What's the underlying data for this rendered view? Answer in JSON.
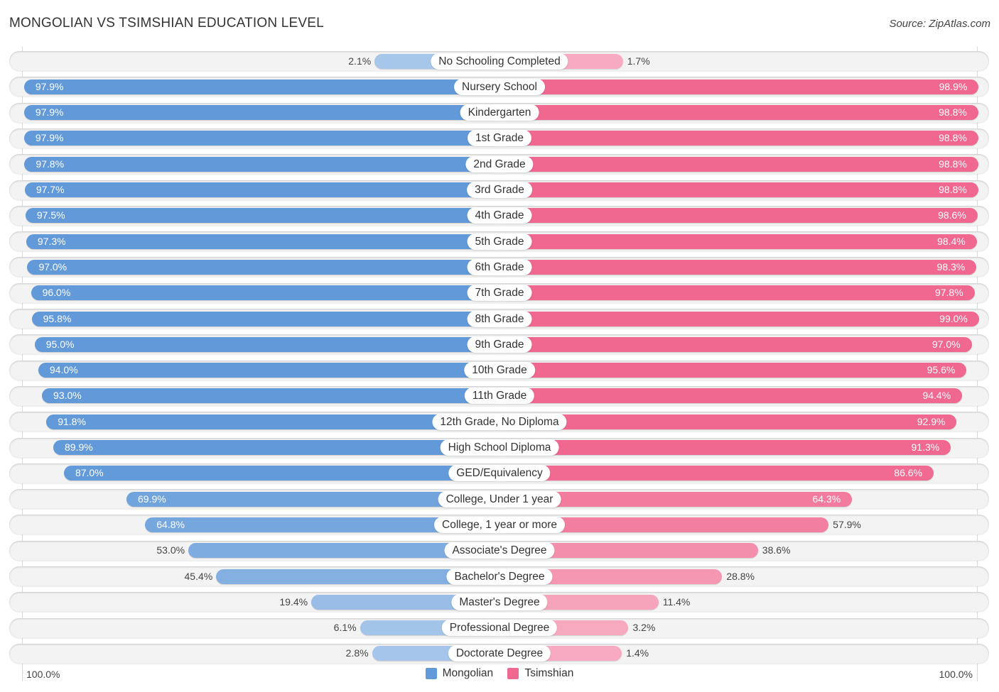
{
  "header": {
    "title": "MONGOLIAN VS TSIMSHIAN EDUCATION LEVEL",
    "source": "Source: ZipAtlas.com"
  },
  "axis": {
    "left_label": "100.0%",
    "right_label": "100.0%"
  },
  "legend": {
    "items": [
      {
        "label": "Mongolian",
        "color": "#6199d9"
      },
      {
        "label": "Tsimshian",
        "color": "#f06790"
      }
    ]
  },
  "chart_data": {
    "type": "bar",
    "orientation": "horizontal-diverging",
    "title": "MONGOLIAN VS TSIMSHIAN EDUCATION LEVEL",
    "xlabel": "",
    "ylabel": "",
    "xlim": [
      0,
      100
    ],
    "legend_position": "bottom-center",
    "categories": [
      "No Schooling Completed",
      "Nursery School",
      "Kindergarten",
      "1st Grade",
      "2nd Grade",
      "3rd Grade",
      "4th Grade",
      "5th Grade",
      "6th Grade",
      "7th Grade",
      "8th Grade",
      "9th Grade",
      "10th Grade",
      "11th Grade",
      "12th Grade, No Diploma",
      "High School Diploma",
      "GED/Equivalency",
      "College, Under 1 year",
      "College, 1 year or more",
      "Associate's Degree",
      "Bachelor's Degree",
      "Master's Degree",
      "Professional Degree",
      "Doctorate Degree"
    ],
    "series": [
      {
        "name": "Mongolian",
        "color": "#6199d9",
        "values": [
          2.1,
          97.9,
          97.9,
          97.9,
          97.8,
          97.7,
          97.5,
          97.3,
          97.0,
          96.0,
          95.8,
          95.0,
          94.0,
          93.0,
          91.8,
          89.9,
          87.0,
          69.9,
          64.8,
          53.0,
          45.4,
          19.4,
          6.1,
          2.8
        ],
        "labels": [
          "2.1%",
          "97.9%",
          "97.9%",
          "97.9%",
          "97.8%",
          "97.7%",
          "97.5%",
          "97.3%",
          "97.0%",
          "96.0%",
          "95.8%",
          "95.0%",
          "94.0%",
          "93.0%",
          "91.8%",
          "89.9%",
          "87.0%",
          "69.9%",
          "64.8%",
          "53.0%",
          "45.4%",
          "19.4%",
          "6.1%",
          "2.8%"
        ]
      },
      {
        "name": "Tsimshian",
        "color": "#f06790",
        "values": [
          1.7,
          98.9,
          98.8,
          98.8,
          98.8,
          98.8,
          98.6,
          98.4,
          98.3,
          97.8,
          99.0,
          97.0,
          95.6,
          94.4,
          92.9,
          91.3,
          86.6,
          64.3,
          57.9,
          38.6,
          28.8,
          11.4,
          3.2,
          1.4
        ],
        "labels": [
          "1.7%",
          "98.9%",
          "98.8%",
          "98.8%",
          "98.8%",
          "98.8%",
          "98.6%",
          "98.4%",
          "98.3%",
          "97.8%",
          "99.0%",
          "97.0%",
          "95.6%",
          "94.4%",
          "92.9%",
          "91.3%",
          "86.6%",
          "64.3%",
          "57.9%",
          "38.6%",
          "28.8%",
          "11.4%",
          "3.2%",
          "1.4%"
        ]
      }
    ]
  }
}
